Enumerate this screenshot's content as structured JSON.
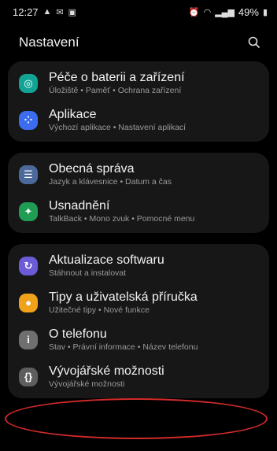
{
  "status_bar": {
    "time": "12:27",
    "battery": "49%"
  },
  "header": {
    "title": "Nastavení"
  },
  "groups": [
    {
      "items": [
        {
          "title": "Péče o baterii a zařízení",
          "subtitle": "Úložiště • Paměť • Ochrana zařízení",
          "icon": "device-care-icon",
          "color": "#13a394"
        },
        {
          "title": "Aplikace",
          "subtitle": "Výchozí aplikace • Nastavení aplikací",
          "icon": "apps-icon",
          "color": "#3c6cf0"
        }
      ]
    },
    {
      "items": [
        {
          "title": "Obecná správa",
          "subtitle": "Jazyk a klávesnice • Datum a čas",
          "icon": "general-management-icon",
          "color": "#4b6a9b"
        },
        {
          "title": "Usnadnění",
          "subtitle": "TalkBack • Mono zvuk • Pomocné menu",
          "icon": "accessibility-icon",
          "color": "#1f9d55"
        }
      ]
    },
    {
      "items": [
        {
          "title": "Aktualizace softwaru",
          "subtitle": "Stáhnout a instalovat",
          "icon": "software-update-icon",
          "color": "#6b5bd6"
        },
        {
          "title": "Tipy a uživatelská příručka",
          "subtitle": "Užitečné tipy • Nové funkce",
          "icon": "tips-icon",
          "color": "#f0a21a"
        },
        {
          "title": "O telefonu",
          "subtitle": "Stav • Právní informace • Název telefonu",
          "icon": "about-phone-icon",
          "color": "#6f6f6f"
        },
        {
          "title": "Vývojářské možnosti",
          "subtitle": "Vývojářské možnosti",
          "icon": "developer-options-icon",
          "color": "#5e5e5e"
        }
      ]
    }
  ],
  "highlight_color": "#d32a2a"
}
